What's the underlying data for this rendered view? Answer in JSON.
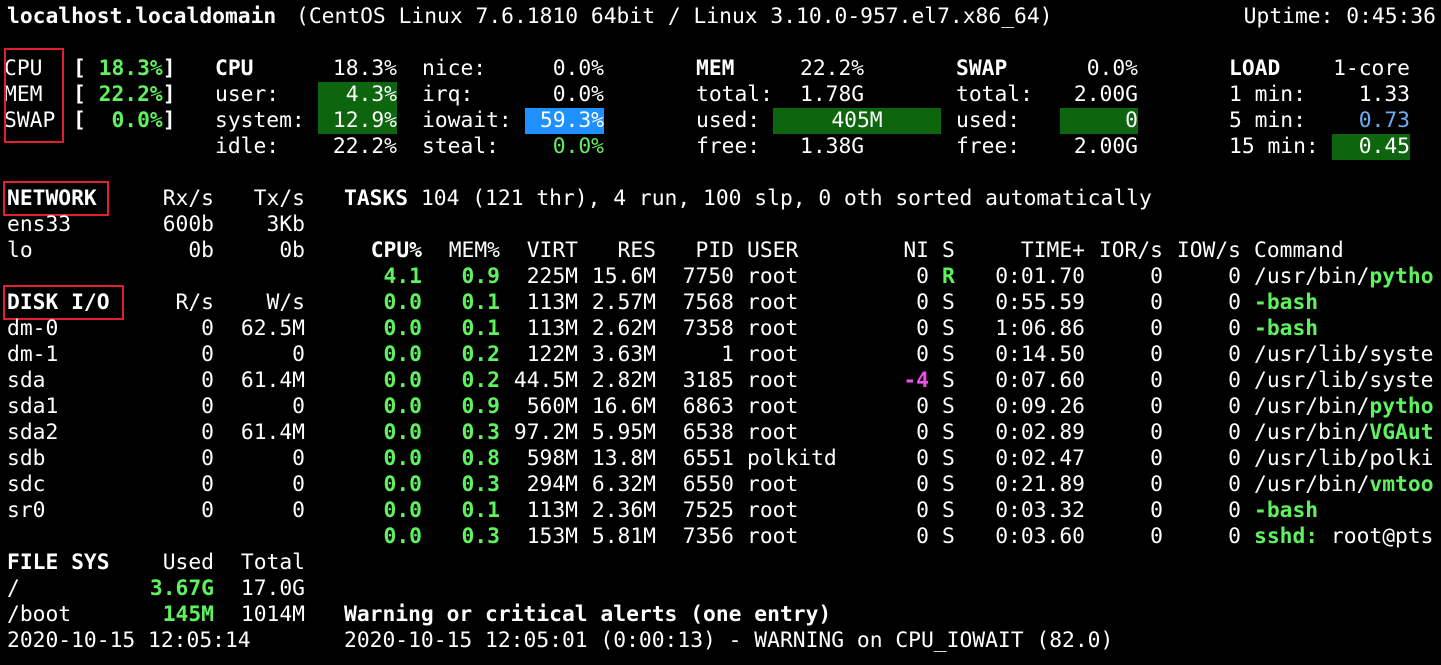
{
  "header": {
    "hostname": "localhost.localdomain",
    "os": "(CentOS Linux 7.6.1810 64bit / Linux 3.10.0-957.el7.x86_64)",
    "uptime": "Uptime: 0:45:36"
  },
  "quicklook": [
    {
      "label": "CPU",
      "bar": "[ 18.3%]"
    },
    {
      "label": "MEM",
      "bar": "[ 22.2%]"
    },
    {
      "label": "SWAP",
      "bar": "[  0.0%]"
    }
  ],
  "cpu": {
    "title": "CPU",
    "total": "18.3%",
    "user_label": "user:",
    "user": "4.3%",
    "system_label": "system:",
    "system": "12.9%",
    "idle_label": "idle:",
    "idle": "22.2%",
    "nice_label": "nice:",
    "nice": "0.0%",
    "irq_label": "irq:",
    "irq": "0.0%",
    "iowait_label": "iowait:",
    "iowait": "59.3%",
    "steal_label": "steal:",
    "steal": "0.0%"
  },
  "mem": {
    "title": "MEM",
    "percent": "22.2%",
    "total_label": "total:",
    "total": "1.78G",
    "used_label": "used:",
    "used": "405M",
    "free_label": "free:",
    "free": "1.38G"
  },
  "swap": {
    "title": "SWAP",
    "percent": "0.0%",
    "total_label": "total:",
    "total": "2.00G",
    "used_label": "used:",
    "used": "0",
    "free_label": "free:",
    "free": "2.00G"
  },
  "load": {
    "title": "LOAD",
    "cores": "1-core",
    "m1_label": "1 min:",
    "m1": "1.33",
    "m5_label": "5 min:",
    "m5": "0.73",
    "m15_label": "15 min:",
    "m15": "0.45"
  },
  "network": {
    "title": "NETWORK",
    "rx": "Rx/s",
    "tx": "Tx/s",
    "rows": [
      {
        "name": "ens33",
        "rx": "600b",
        "tx": "3Kb"
      },
      {
        "name": "lo",
        "rx": "0b",
        "tx": "0b"
      }
    ]
  },
  "disk": {
    "title": "DISK I/O",
    "r": "R/s",
    "w": "W/s",
    "rows": [
      {
        "name": "dm-0",
        "r": "0",
        "w": "62.5M"
      },
      {
        "name": "dm-1",
        "r": "0",
        "w": "0"
      },
      {
        "name": "sda",
        "r": "0",
        "w": "61.4M"
      },
      {
        "name": "sda1",
        "r": "0",
        "w": "0"
      },
      {
        "name": "sda2",
        "r": "0",
        "w": "61.4M"
      },
      {
        "name": "sdb",
        "r": "0",
        "w": "0"
      },
      {
        "name": "sdc",
        "r": "0",
        "w": "0"
      },
      {
        "name": "sr0",
        "r": "0",
        "w": "0"
      }
    ]
  },
  "fs": {
    "title": "FILE SYS",
    "used": "Used",
    "total": "Total",
    "rows": [
      {
        "name": "/",
        "used": "3.67G",
        "total": "17.0G"
      },
      {
        "name": "/boot",
        "used": "145M",
        "total": "1014M"
      }
    ]
  },
  "timestamp": "2020-10-15 12:05:14",
  "tasks": {
    "title": "TASKS",
    "summary": "104 (121 thr), 4 run, 100 slp, 0 oth sorted automatically"
  },
  "proc_headers": {
    "cpu": "CPU%",
    "mem": "MEM%",
    "virt": "VIRT",
    "res": "RES",
    "pid": "PID",
    "user": "USER",
    "ni": "NI",
    "s": "S",
    "time": "TIME+",
    "ior": "IOR/s",
    "iow": "IOW/s",
    "cmd": "Command"
  },
  "processes": [
    {
      "cpu": "4.1",
      "mem": "0.9",
      "virt": "225M",
      "res": "15.6M",
      "pid": "7750",
      "user": "root",
      "ni": "0",
      "s": "R",
      "time": "0:01.70",
      "ior": "0",
      "iow": "0",
      "cmd_path": "/usr/bin/",
      "cmd_name": "pytho",
      "cmd_args": ""
    },
    {
      "cpu": "0.0",
      "mem": "0.1",
      "virt": "113M",
      "res": "2.57M",
      "pid": "7568",
      "user": "root",
      "ni": "0",
      "s": "S",
      "time": "0:55.59",
      "ior": "0",
      "iow": "0",
      "cmd_path": "",
      "cmd_name": "-bash",
      "cmd_args": ""
    },
    {
      "cpu": "0.0",
      "mem": "0.1",
      "virt": "113M",
      "res": "2.62M",
      "pid": "7358",
      "user": "root",
      "ni": "0",
      "s": "S",
      "time": "1:06.86",
      "ior": "0",
      "iow": "0",
      "cmd_path": "",
      "cmd_name": "-bash",
      "cmd_args": ""
    },
    {
      "cpu": "0.0",
      "mem": "0.2",
      "virt": "122M",
      "res": "3.63M",
      "pid": "1",
      "user": "root",
      "ni": "0",
      "s": "S",
      "time": "0:14.50",
      "ior": "0",
      "iow": "0",
      "cmd_path": "/usr/lib/syste",
      "cmd_name": "",
      "cmd_args": ""
    },
    {
      "cpu": "0.0",
      "mem": "0.2",
      "virt": "44.5M",
      "res": "2.82M",
      "pid": "3185",
      "user": "root",
      "ni": "-4",
      "s": "S",
      "time": "0:07.60",
      "ior": "0",
      "iow": "0",
      "cmd_path": "/usr/lib/syste",
      "cmd_name": "",
      "cmd_args": ""
    },
    {
      "cpu": "0.0",
      "mem": "0.9",
      "virt": "560M",
      "res": "16.6M",
      "pid": "6863",
      "user": "root",
      "ni": "0",
      "s": "S",
      "time": "0:09.26",
      "ior": "0",
      "iow": "0",
      "cmd_path": "/usr/bin/",
      "cmd_name": "pytho",
      "cmd_args": ""
    },
    {
      "cpu": "0.0",
      "mem": "0.3",
      "virt": "97.2M",
      "res": "5.95M",
      "pid": "6538",
      "user": "root",
      "ni": "0",
      "s": "S",
      "time": "0:02.89",
      "ior": "0",
      "iow": "0",
      "cmd_path": "/usr/bin/",
      "cmd_name": "VGAut",
      "cmd_args": ""
    },
    {
      "cpu": "0.0",
      "mem": "0.8",
      "virt": "598M",
      "res": "13.8M",
      "pid": "6551",
      "user": "polkitd",
      "ni": "0",
      "s": "S",
      "time": "0:02.47",
      "ior": "0",
      "iow": "0",
      "cmd_path": "/usr/lib/polki",
      "cmd_name": "",
      "cmd_args": ""
    },
    {
      "cpu": "0.0",
      "mem": "0.3",
      "virt": "294M",
      "res": "6.32M",
      "pid": "6550",
      "user": "root",
      "ni": "0",
      "s": "S",
      "time": "0:21.89",
      "ior": "0",
      "iow": "0",
      "cmd_path": "/usr/bin/",
      "cmd_name": "vmtoo",
      "cmd_args": ""
    },
    {
      "cpu": "0.0",
      "mem": "0.1",
      "virt": "113M",
      "res": "2.36M",
      "pid": "7525",
      "user": "root",
      "ni": "0",
      "s": "S",
      "time": "0:03.32",
      "ior": "0",
      "iow": "0",
      "cmd_path": "",
      "cmd_name": "-bash",
      "cmd_args": ""
    },
    {
      "cpu": "0.0",
      "mem": "0.3",
      "virt": "153M",
      "res": "5.81M",
      "pid": "7356",
      "user": "root",
      "ni": "0",
      "s": "S",
      "time": "0:03.60",
      "ior": "0",
      "iow": "0",
      "cmd_path": "",
      "cmd_name": "sshd:",
      "cmd_args": " root@pts"
    }
  ],
  "alerts": {
    "title": "Warning or critical alerts (one entry)",
    "entry": "2020-10-15 12:05:01 (0:00:13) - WARNING on CPU_IOWAIT (82.0)"
  }
}
